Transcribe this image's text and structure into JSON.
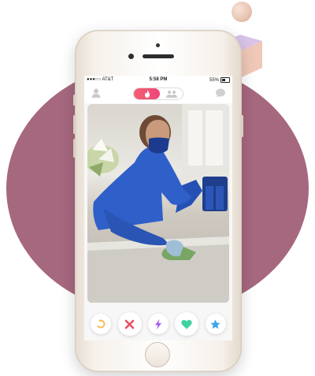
{
  "colors": {
    "mauve": "#a6687e",
    "brand_gradient_start": "#f2616f",
    "brand_gradient_end": "#f0447a",
    "rewind": "#f5b748",
    "nope": "#ec4e63",
    "boost": "#a55cf0",
    "like": "#3fd2a0",
    "super_like": "#3ea4ec"
  },
  "status_bar": {
    "carrier": "●●●○○ AT&T",
    "time": "5:58 PM",
    "battery": "55%"
  },
  "header": {
    "left_icon": "profile-icon",
    "toggle_left_icon": "flame-icon",
    "toggle_right_icon": "group-icon",
    "right_icon": "chat-icon"
  },
  "card": {
    "image": "photo of a masked cleaner in blue scrubs wiping a marble countertop with a green cloth"
  },
  "actions": [
    {
      "name": "rewind",
      "icon": "rewind-icon"
    },
    {
      "name": "nope",
      "icon": "close-icon"
    },
    {
      "name": "boost",
      "icon": "lightning-icon"
    },
    {
      "name": "like",
      "icon": "heart-icon"
    },
    {
      "name": "super-like",
      "icon": "star-icon"
    }
  ]
}
